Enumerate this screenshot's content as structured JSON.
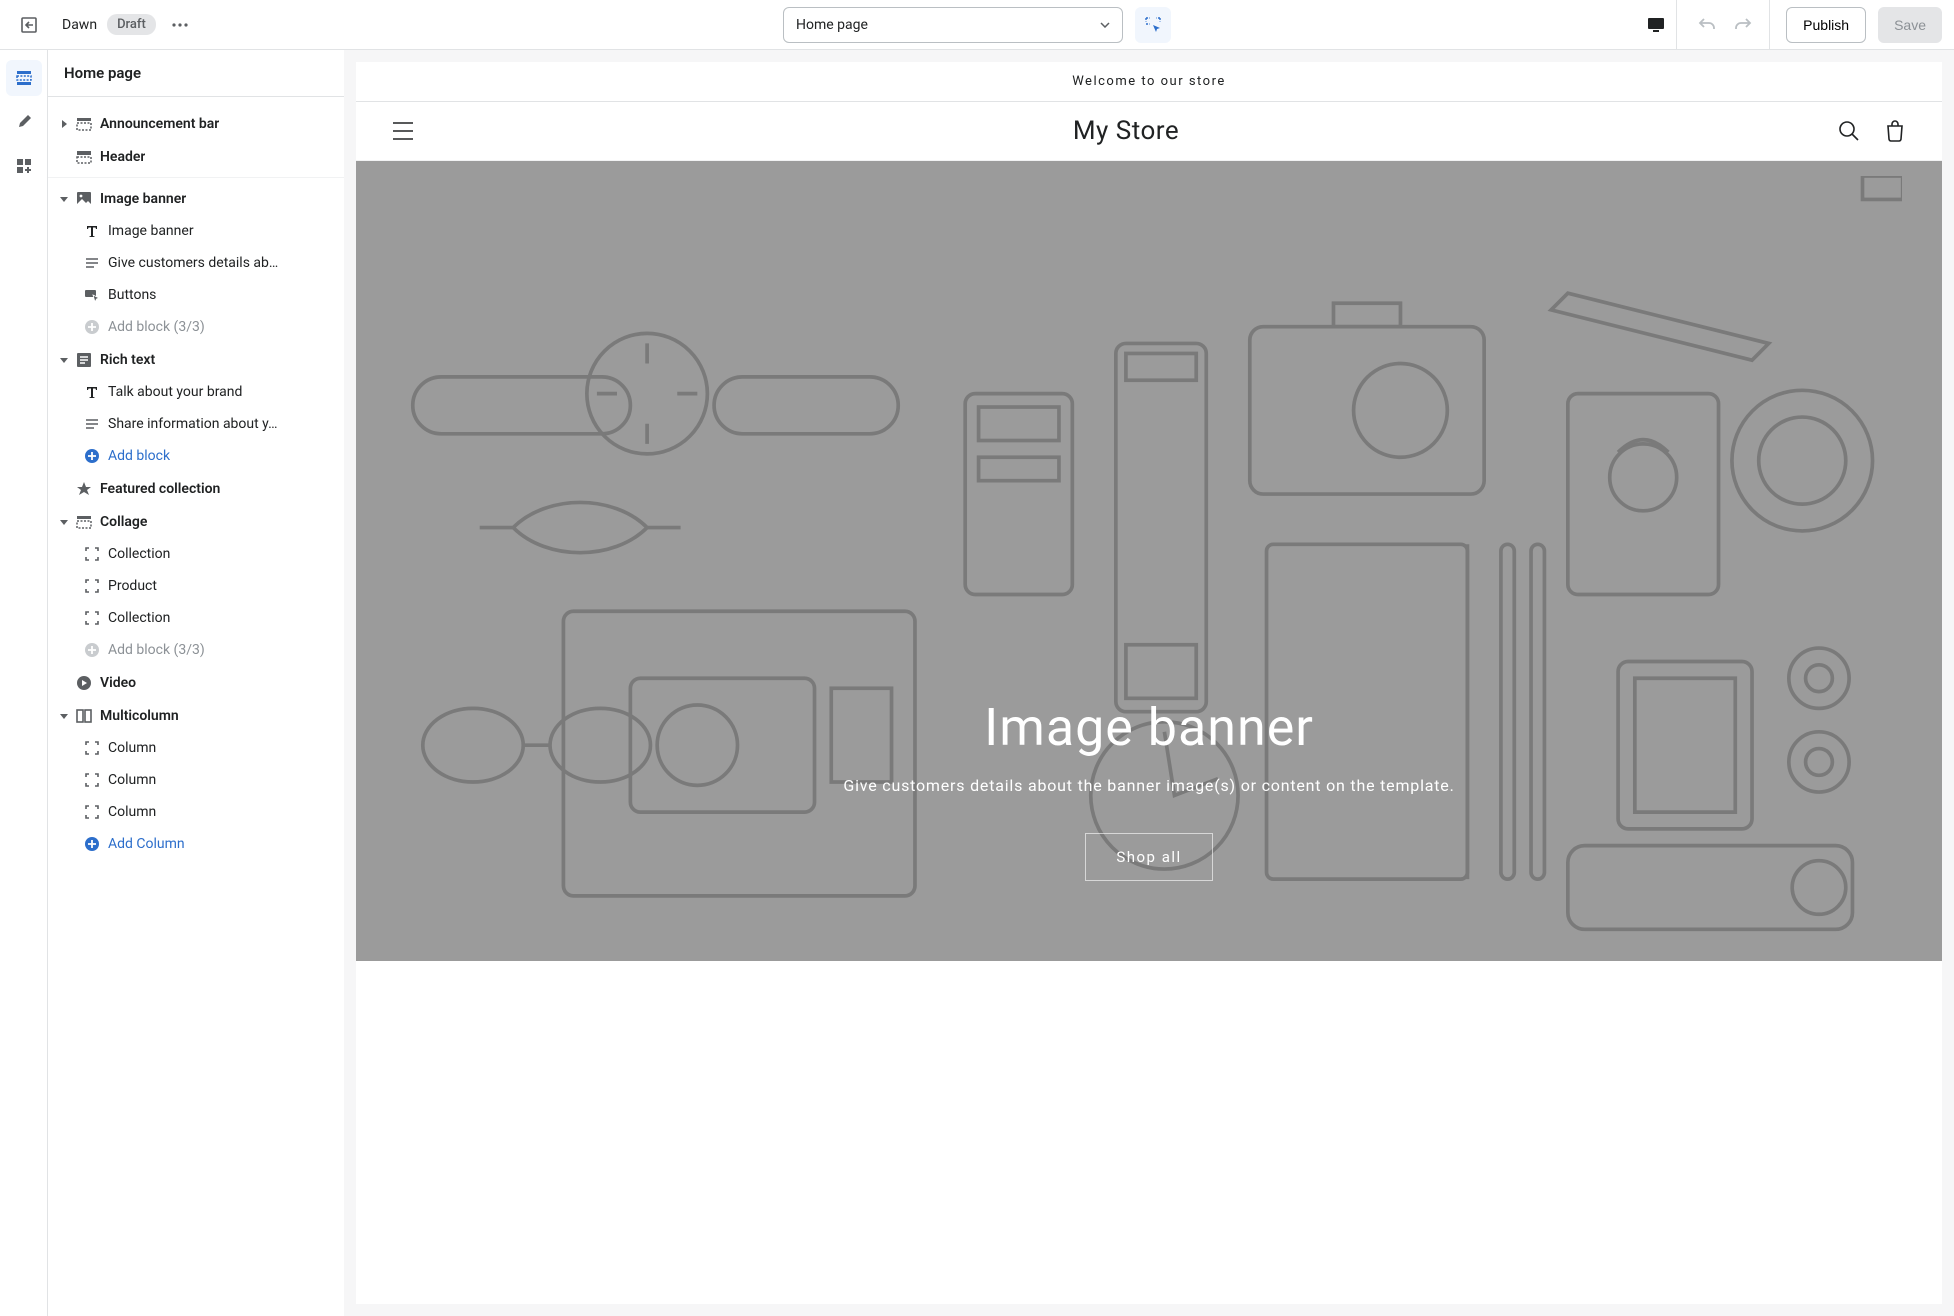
{
  "topBar": {
    "themeName": "Dawn",
    "statusBadge": "Draft",
    "pageSelectLabel": "Home page",
    "publish": "Publish",
    "save": "Save"
  },
  "sidebar": {
    "title": "Home page",
    "sections": [
      {
        "id": "announcement",
        "label": "Announcement bar",
        "icon": "announce",
        "chevron": "right",
        "children": []
      },
      {
        "id": "header",
        "label": "Header",
        "icon": "header",
        "chevron": "none",
        "children": []
      }
    ],
    "templateSections": [
      {
        "id": "image-banner",
        "label": "Image banner",
        "icon": "image",
        "chevron": "down",
        "children": [
          {
            "icon": "T",
            "label": "Image banner"
          },
          {
            "icon": "lines",
            "label": "Give customers details ab…"
          },
          {
            "icon": "buttons",
            "label": "Buttons"
          },
          {
            "icon": "plus-disabled",
            "label": "Add block (3/3)",
            "cls": "disabled"
          }
        ]
      },
      {
        "id": "rich-text",
        "label": "Rich text",
        "icon": "richtext",
        "chevron": "down",
        "children": [
          {
            "icon": "T",
            "label": "Talk about your brand"
          },
          {
            "icon": "lines",
            "label": "Share information about y…"
          },
          {
            "icon": "plus",
            "label": "Add block",
            "cls": "add-block"
          }
        ]
      },
      {
        "id": "featured",
        "label": "Featured collection",
        "icon": "featured",
        "chevron": "none",
        "children": []
      },
      {
        "id": "collage",
        "label": "Collage",
        "icon": "collage",
        "chevron": "down",
        "children": [
          {
            "icon": "fullscreen",
            "label": "Collection"
          },
          {
            "icon": "fullscreen",
            "label": "Product"
          },
          {
            "icon": "fullscreen",
            "label": "Collection"
          },
          {
            "icon": "plus-disabled",
            "label": "Add block (3/3)",
            "cls": "disabled"
          }
        ]
      },
      {
        "id": "video",
        "label": "Video",
        "icon": "video",
        "chevron": "none",
        "children": []
      },
      {
        "id": "multicolumn",
        "label": "Multicolumn",
        "icon": "multicolumn",
        "chevron": "down",
        "children": [
          {
            "icon": "fullscreen",
            "label": "Column"
          },
          {
            "icon": "fullscreen",
            "label": "Column"
          },
          {
            "icon": "fullscreen",
            "label": "Column"
          },
          {
            "icon": "plus",
            "label": "Add Column",
            "cls": "add-block"
          }
        ]
      }
    ]
  },
  "preview": {
    "announcement": "Welcome to our store",
    "storeTitle": "My Store",
    "bannerTitle": "Image banner",
    "bannerSubtitle": "Give customers details about the banner image(s) or content on the template.",
    "bannerButton": "Shop all"
  }
}
